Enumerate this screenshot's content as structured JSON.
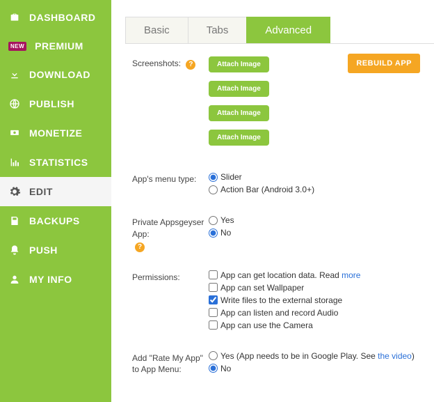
{
  "sidebar": {
    "items": [
      {
        "label": "DASHBOARD",
        "icon": "briefcase-icon"
      },
      {
        "label": "PREMIUM",
        "icon": "new-badge",
        "badge": "NEW"
      },
      {
        "label": "DOWNLOAD",
        "icon": "download-icon"
      },
      {
        "label": "PUBLISH",
        "icon": "globe-icon"
      },
      {
        "label": "MONETIZE",
        "icon": "money-icon"
      },
      {
        "label": "STATISTICS",
        "icon": "chart-icon"
      },
      {
        "label": "EDIT",
        "icon": "gear-icon",
        "active": true
      },
      {
        "label": "BACKUPS",
        "icon": "save-icon"
      },
      {
        "label": "PUSH",
        "icon": "bell-icon"
      },
      {
        "label": "MY INFO",
        "icon": "user-icon"
      }
    ]
  },
  "tabs": {
    "items": [
      "Basic",
      "Tabs",
      "Advanced"
    ],
    "active": "Advanced"
  },
  "rebuild_label": "REBUILD APP",
  "screenshots": {
    "label": "Screenshots:",
    "attach_label": "Attach Image"
  },
  "menu_type": {
    "label": "App's menu type:",
    "options": [
      "Slider",
      "Action Bar (Android 3.0+)"
    ],
    "selected": "Slider"
  },
  "private": {
    "label": "Private Appsgeyser App:",
    "options": [
      "Yes",
      "No"
    ],
    "selected": "No"
  },
  "permissions": {
    "label": "Permissions:",
    "items": [
      {
        "text": "App can get location data. Read ",
        "link": "more",
        "checked": false
      },
      {
        "text": "App can set Wallpaper",
        "checked": false
      },
      {
        "text": "Write files to the external storage",
        "checked": true
      },
      {
        "text": "App can listen and record Audio",
        "checked": false
      },
      {
        "text": "App can use the Camera",
        "checked": false
      }
    ]
  },
  "rate": {
    "label1": "Add \"Rate My App\"",
    "label2": "to App Menu:",
    "opt_yes": "Yes (App needs to be in Google Play. See ",
    "link": "the video",
    "opt_yes_tail": ")",
    "opt_no": "No",
    "selected": "No"
  }
}
